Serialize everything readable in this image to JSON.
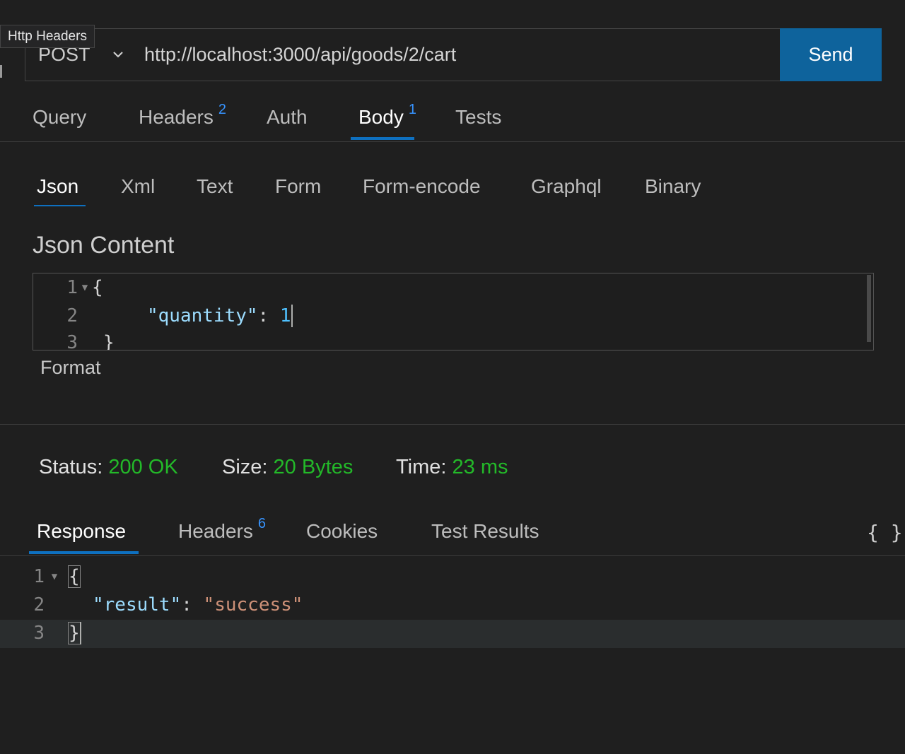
{
  "tooltip": "Http Headers",
  "request": {
    "method": "POST",
    "url": "http://localhost:3000/api/goods/2/cart",
    "send_label": "Send"
  },
  "request_tabs": [
    {
      "label": "Query",
      "badge": ""
    },
    {
      "label": "Headers",
      "badge": "2"
    },
    {
      "label": "Auth",
      "badge": ""
    },
    {
      "label": "Body",
      "badge": "1",
      "active": true
    },
    {
      "label": "Tests",
      "badge": ""
    }
  ],
  "body_tabs": [
    {
      "label": "Json",
      "active": true
    },
    {
      "label": "Xml"
    },
    {
      "label": "Text"
    },
    {
      "label": "Form"
    },
    {
      "label": "Form-encode"
    },
    {
      "label": "Graphql"
    },
    {
      "label": "Binary"
    }
  ],
  "json_content": {
    "title": "Json Content",
    "line_numbers": [
      "1",
      "2",
      "3"
    ],
    "open_brace": "{",
    "key": "\"quantity\"",
    "colon": ": ",
    "value": "1",
    "close_brace": "}",
    "format_label": "Format"
  },
  "status": {
    "status_label": "Status:",
    "status_value": "200 OK",
    "size_label": "Size:",
    "size_value": "20 Bytes",
    "time_label": "Time:",
    "time_value": "23 ms"
  },
  "response_tabs": [
    {
      "label": "Response",
      "badge": "",
      "active": true
    },
    {
      "label": "Headers",
      "badge": "6"
    },
    {
      "label": "Cookies",
      "badge": ""
    },
    {
      "label": "Test Results",
      "badge": ""
    }
  ],
  "braces_label": "{ }",
  "response": {
    "line_numbers": [
      "1",
      "2",
      "3"
    ],
    "open_brace": "{",
    "key": "\"result\"",
    "colon": ": ",
    "value": "\"success\"",
    "close_brace": "}"
  },
  "colors": {
    "accent": "#0e639c",
    "underline": "#0e70c0",
    "status_green": "#23b929",
    "badge_blue": "#3794ff"
  }
}
